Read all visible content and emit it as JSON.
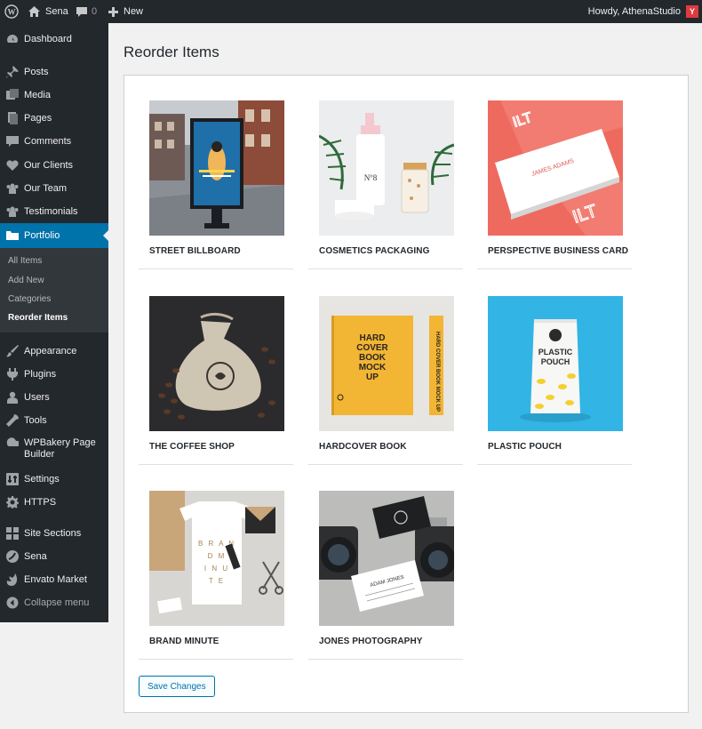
{
  "adminbar": {
    "wp_icon": "wordpress-logo-icon",
    "site_name": "Sena",
    "comments_count": "0",
    "new_label": "New",
    "howdy": "Howdy, AthenaStudio",
    "avatar_initial": "Y"
  },
  "sidebar": {
    "dashboard": "Dashboard",
    "posts": "Posts",
    "media": "Media",
    "pages": "Pages",
    "comments": "Comments",
    "our_clients": "Our Clients",
    "our_team": "Our Team",
    "testimonials": "Testimonials",
    "portfolio": "Portfolio",
    "submenu": {
      "all_items": "All Items",
      "add_new": "Add New",
      "categories": "Categories",
      "reorder_items": "Reorder Items"
    },
    "appearance": "Appearance",
    "plugins": "Plugins",
    "users": "Users",
    "tools": "Tools",
    "wpbakery_line1": "WPBakery Page",
    "wpbakery_line2": "Builder",
    "settings": "Settings",
    "https": "HTTPS",
    "site_sections": "Site Sections",
    "sena": "Sena",
    "envato_market": "Envato Market",
    "collapse_menu": "Collapse menu"
  },
  "main": {
    "title": "Reorder Items",
    "items": [
      {
        "title": "STREET BILLBOARD"
      },
      {
        "title": "COSMETICS PACKAGING"
      },
      {
        "title": "PERSPECTIVE BUSINESS CARD"
      },
      {
        "title": "THE COFFEE SHOP"
      },
      {
        "title": "HARDCOVER BOOK"
      },
      {
        "title": "PLASTIC POUCH"
      },
      {
        "title": "BRAND MINUTE"
      },
      {
        "title": "JONES PHOTOGRAPHY"
      }
    ],
    "save_label": "Save Changes"
  },
  "thumbnail_text": {
    "cosmetics_label": "N°8",
    "business_card_name": "JAMES ADAMS",
    "business_card_logo": "ILT",
    "book_text": "HARD COVER BOOK MOCK UP",
    "pouch_line1": "PLASTIC",
    "pouch_line2": "POUCH",
    "brand_text": "B R A N D M I N U T E",
    "jones_card_name": "ADAM JONES"
  },
  "colors": {
    "admin_bar": "#23282d",
    "accent": "#0073aa",
    "avatar": "#e0393e",
    "card_salmon": "#ee6a5f",
    "book_yellow": "#f2b534",
    "pouch_bg": "#32b4e5"
  }
}
